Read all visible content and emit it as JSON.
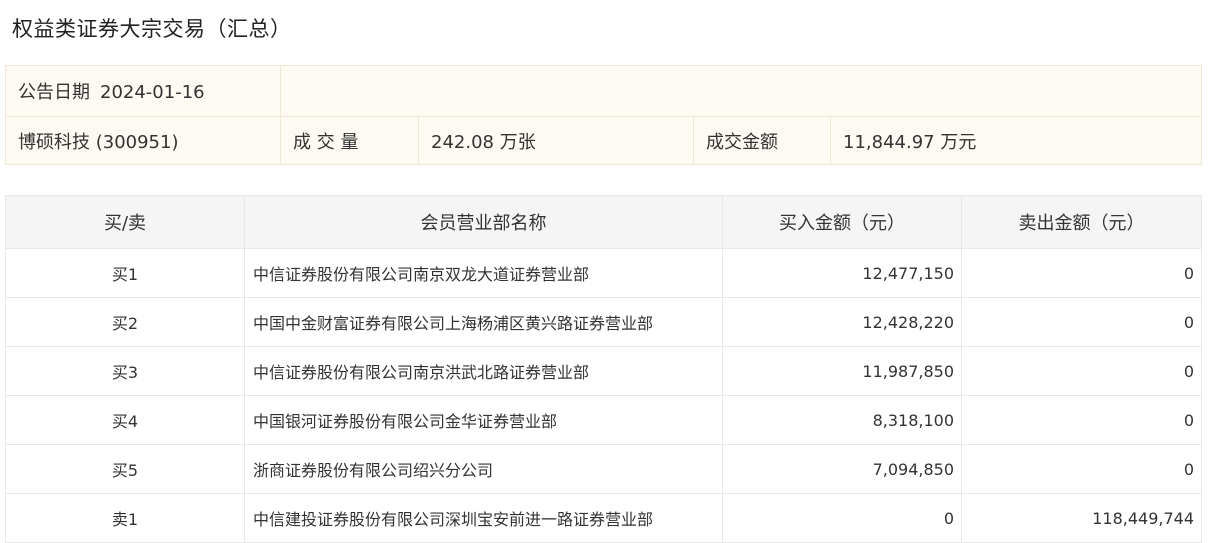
{
  "title": "权益类证券大宗交易（汇总）",
  "summary": {
    "date_label": "公告日期",
    "date_value": "2024-01-16",
    "stock": "博硕科技 (300951)",
    "volume_label": "成 交 量",
    "volume_value": "242.08 万张",
    "amount_label": "成交金额",
    "amount_value": "11,844.97 万元"
  },
  "table": {
    "headers": [
      "买/卖",
      "会员营业部名称",
      "买入金额（元）",
      "卖出金额（元）"
    ],
    "rows": [
      {
        "side": "买1",
        "branch": "中信证券股份有限公司南京双龙大道证券营业部",
        "buy": "12,477,150",
        "sell": "0"
      },
      {
        "side": "买2",
        "branch": "中国中金财富证券有限公司上海杨浦区黄兴路证券营业部",
        "buy": "12,428,220",
        "sell": "0"
      },
      {
        "side": "买3",
        "branch": "中信证券股份有限公司南京洪武北路证券营业部",
        "buy": "11,987,850",
        "sell": "0"
      },
      {
        "side": "买4",
        "branch": "中国银河证券股份有限公司金华证券营业部",
        "buy": "8,318,100",
        "sell": "0"
      },
      {
        "side": "买5",
        "branch": "浙商证券股份有限公司绍兴分公司",
        "buy": "7,094,850",
        "sell": "0"
      },
      {
        "side": "卖1",
        "branch": "中信建投证券股份有限公司深圳宝安前进一路证券营业部",
        "buy": "0",
        "sell": "118,449,744"
      }
    ]
  }
}
